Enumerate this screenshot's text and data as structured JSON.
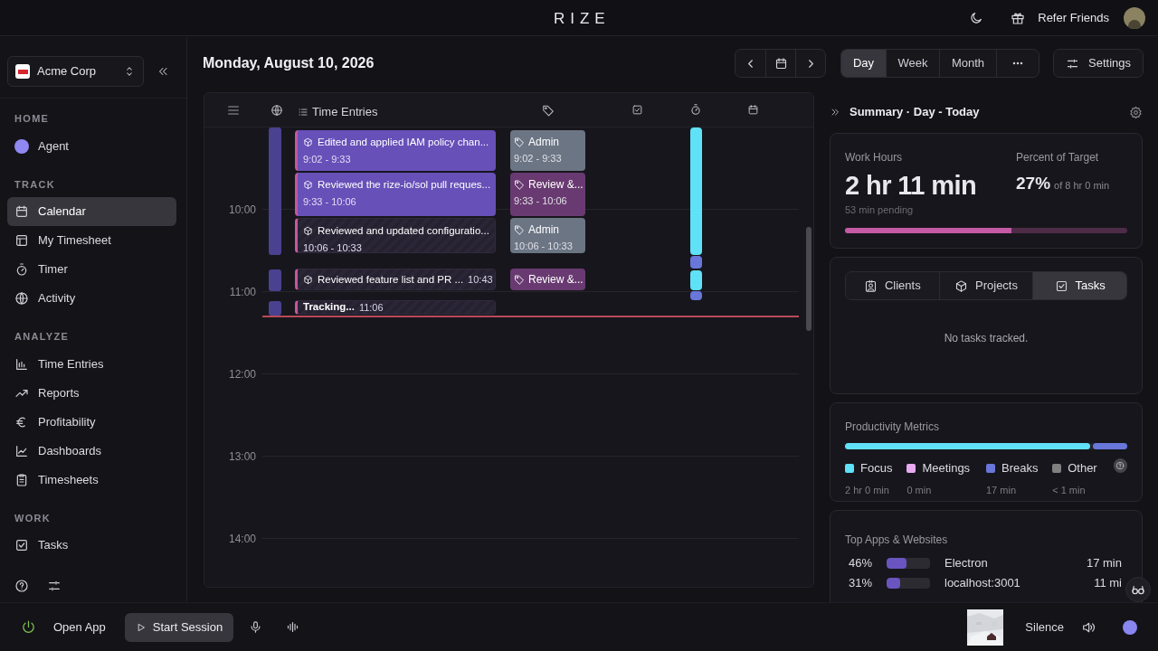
{
  "app": {
    "logo": "RIZE",
    "refer": "Refer Friends"
  },
  "workspace": {
    "name": "Acme Corp"
  },
  "sidebar": {
    "sections": [
      {
        "title": "HOME",
        "items": [
          {
            "label": "Agent",
            "selected": false
          }
        ]
      },
      {
        "title": "TRACK",
        "items": [
          {
            "label": "Calendar",
            "selected": true
          },
          {
            "label": "My Timesheet",
            "selected": false
          },
          {
            "label": "Timer",
            "selected": false
          },
          {
            "label": "Activity",
            "selected": false
          }
        ]
      },
      {
        "title": "ANALYZE",
        "items": [
          {
            "label": "Time Entries",
            "selected": false
          },
          {
            "label": "Reports",
            "selected": false
          },
          {
            "label": "Profitability",
            "selected": false
          },
          {
            "label": "Dashboards",
            "selected": false
          },
          {
            "label": "Timesheets",
            "selected": false
          }
        ]
      },
      {
        "title": "WORK",
        "items": [
          {
            "label": "Tasks",
            "selected": false
          }
        ]
      }
    ]
  },
  "header": {
    "date": "Monday, August 10, 2026",
    "views": [
      {
        "label": "Day",
        "selected": true
      },
      {
        "label": "Week",
        "selected": false
      },
      {
        "label": "Month",
        "selected": false
      }
    ],
    "settings": "Settings"
  },
  "calendar": {
    "column_title": "Time Entries",
    "hours": [
      {
        "label": "10:00"
      },
      {
        "label": "11:00"
      },
      {
        "label": "12:00"
      },
      {
        "label": "13:00"
      },
      {
        "label": "14:00"
      }
    ],
    "entries": [
      {
        "kind": "solid",
        "title": "Edited and applied IAM policy chan...",
        "time": "9:02 - 9:33"
      },
      {
        "kind": "solid",
        "title": "Reviewed the rize-io/sol pull reques...",
        "time": "9:33 - 10:06"
      },
      {
        "kind": "hatched",
        "title": "Reviewed and updated configuratio...",
        "time": "10:06 - 10:33"
      },
      {
        "kind": "inline",
        "title": "Reviewed feature list and PR ...",
        "time": "10:43"
      },
      {
        "kind": "tracking",
        "title": "Tracking...",
        "time": "11:06"
      }
    ],
    "tags": [
      {
        "label": "Admin",
        "time": "9:02 - 9:33",
        "color": "#6b7584"
      },
      {
        "label": "Review &...",
        "time": "9:33 - 10:06",
        "color": "#693a71"
      },
      {
        "label": "Admin",
        "time": "10:06 - 10:33",
        "color": "#6b7584"
      },
      {
        "label": "Review &...",
        "color": "#693a71"
      }
    ]
  },
  "summary": {
    "title": "Summary · Day - Today",
    "work_hours": {
      "label": "Work Hours",
      "value": "2 hr 11 min",
      "pending": "53 min pending",
      "level": 0.59
    },
    "target": {
      "label": "Percent of Target",
      "value": "27%",
      "of": "of 8 hr 0 min"
    },
    "tabs": [
      {
        "label": "Clients",
        "selected": false
      },
      {
        "label": "Projects",
        "selected": false
      },
      {
        "label": "Tasks",
        "selected": true
      }
    ],
    "empty": "No tasks tracked.",
    "metrics": {
      "title": "Productivity Metrics",
      "segments": [
        {
          "level": 0.87,
          "color": "#5fe1f7"
        },
        {
          "level": 0.13,
          "color": "#6877d9"
        }
      ],
      "legend": [
        {
          "label": "Focus",
          "value": "2 hr 0 min",
          "color": "#5fe1f7"
        },
        {
          "label": "Meetings",
          "value": "0 min",
          "color": "#e7a9f0"
        },
        {
          "label": "Breaks",
          "value": "17 min",
          "color": "#6877d9"
        },
        {
          "label": "Other",
          "value": "< 1 min",
          "color": "#808080"
        }
      ]
    },
    "apps": {
      "title": "Top Apps & Websites",
      "rows": [
        {
          "percent": "46%",
          "level": 0.46,
          "name": "Electron",
          "time": "17 min"
        },
        {
          "percent": "31%",
          "level": 0.31,
          "name": "localhost:3001",
          "time": "11 mi"
        }
      ]
    }
  },
  "bottom_bar": {
    "open_app": "Open App",
    "start_session": "Start Session",
    "track": "Silence"
  }
}
